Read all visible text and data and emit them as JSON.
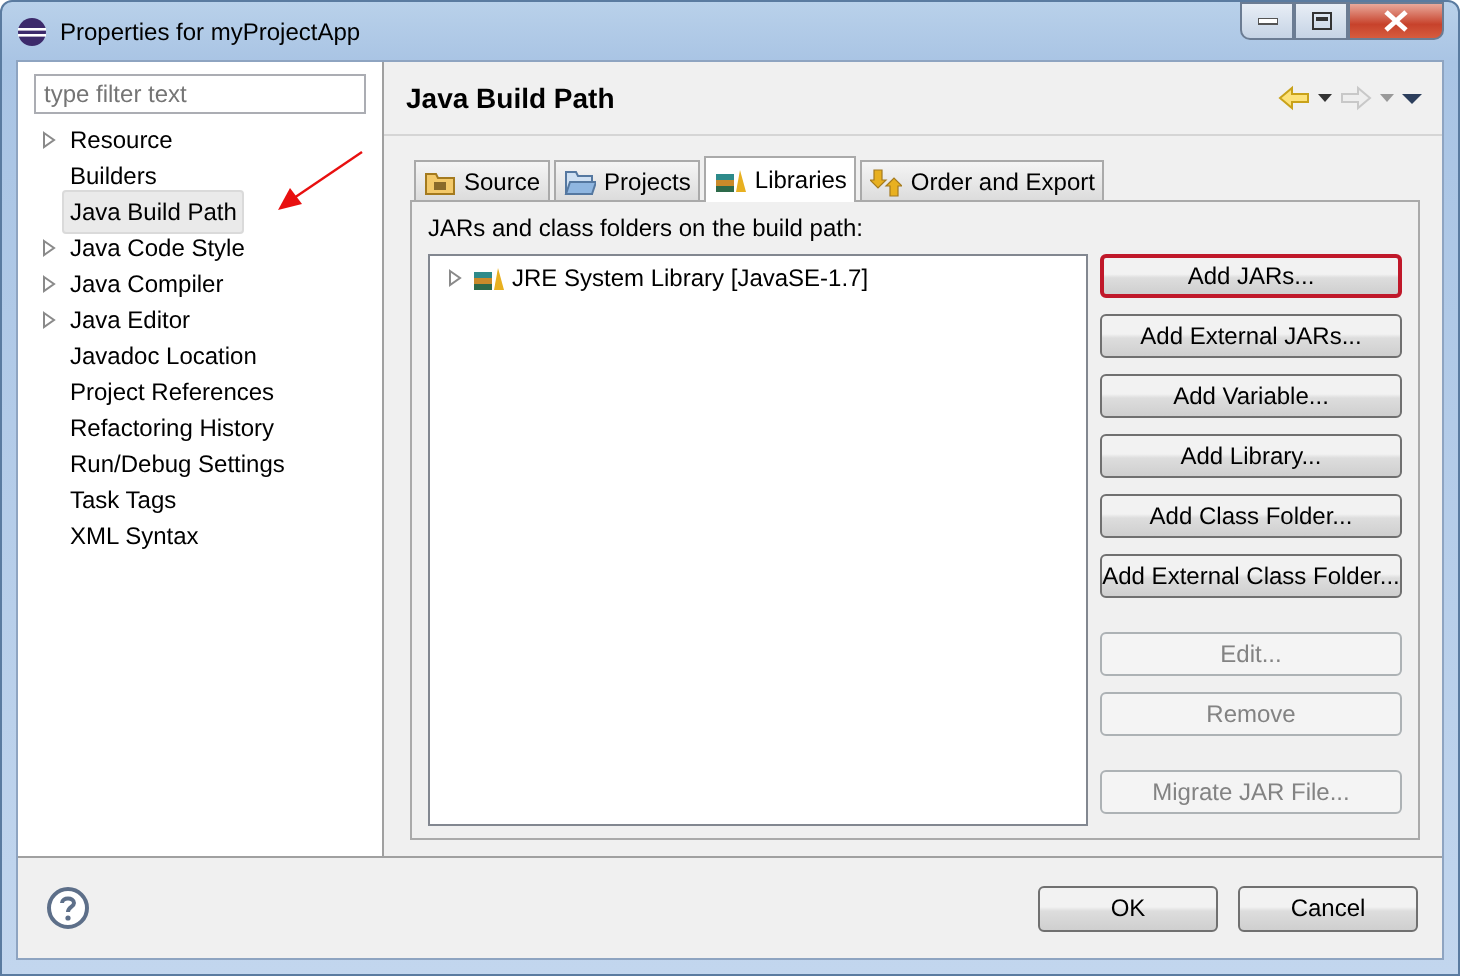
{
  "window": {
    "title": "Properties for myProjectApp"
  },
  "filter": {
    "placeholder": "type filter text"
  },
  "sidebar": {
    "items": [
      {
        "label": "Resource",
        "expandable": true,
        "selected": false
      },
      {
        "label": "Builders",
        "expandable": false,
        "selected": false
      },
      {
        "label": "Java Build Path",
        "expandable": false,
        "selected": true
      },
      {
        "label": "Java Code Style",
        "expandable": true,
        "selected": false
      },
      {
        "label": "Java Compiler",
        "expandable": true,
        "selected": false
      },
      {
        "label": "Java Editor",
        "expandable": true,
        "selected": false
      },
      {
        "label": "Javadoc Location",
        "expandable": false,
        "selected": false
      },
      {
        "label": "Project References",
        "expandable": false,
        "selected": false
      },
      {
        "label": "Refactoring History",
        "expandable": false,
        "selected": false
      },
      {
        "label": "Run/Debug Settings",
        "expandable": false,
        "selected": false
      },
      {
        "label": "Task Tags",
        "expandable": false,
        "selected": false
      },
      {
        "label": "XML Syntax",
        "expandable": false,
        "selected": false
      }
    ]
  },
  "page": {
    "title": "Java Build Path",
    "navigation": [
      {
        "kind": "back",
        "disabled": false
      },
      {
        "kind": "forward",
        "disabled": true
      }
    ]
  },
  "tabs": [
    {
      "label": "Source",
      "kind": "source",
      "selected": false
    },
    {
      "label": "Projects",
      "kind": "projects",
      "selected": false
    },
    {
      "label": "Libraries",
      "kind": "libraries",
      "selected": true
    },
    {
      "label": "Order and Export",
      "kind": "order",
      "selected": false
    }
  ],
  "libraries": {
    "caption": "JARs and class folders on the build path:",
    "tree": [
      {
        "label": "JRE System Library [JavaSE-1.7]",
        "expanded": false
      }
    ],
    "button_groups": [
      [
        {
          "label": "Add JARs...",
          "disabled": false,
          "highlighted": true
        },
        {
          "label": "Add External JARs...",
          "disabled": false,
          "highlighted": false
        },
        {
          "label": "Add Variable...",
          "disabled": false,
          "highlighted": false
        },
        {
          "label": "Add Library...",
          "disabled": false,
          "highlighted": false
        },
        {
          "label": "Add Class Folder...",
          "disabled": false,
          "highlighted": false
        },
        {
          "label": "Add External Class Folder...",
          "disabled": false,
          "highlighted": false
        }
      ],
      [
        {
          "label": "Edit...",
          "disabled": true,
          "highlighted": false
        },
        {
          "label": "Remove",
          "disabled": true,
          "highlighted": false
        }
      ],
      [
        {
          "label": "Migrate JAR File...",
          "disabled": true,
          "highlighted": false
        }
      ]
    ]
  },
  "footer": {
    "buttons": [
      "OK",
      "Cancel"
    ]
  }
}
